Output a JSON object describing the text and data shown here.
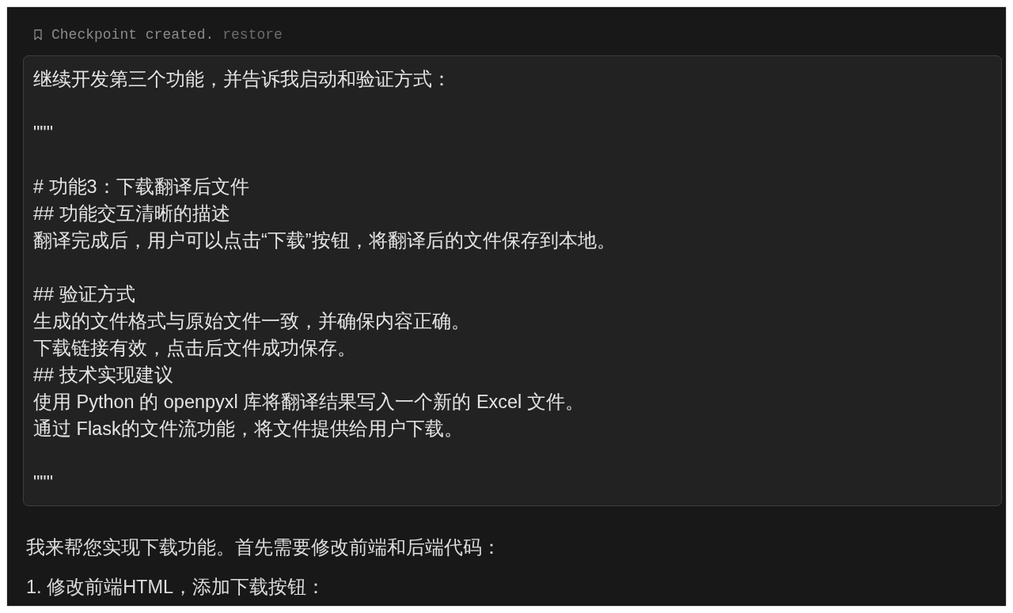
{
  "checkpoint": {
    "label": "Checkpoint created.",
    "action": "restore"
  },
  "user_message": {
    "blocks": [
      [
        "继续开发第三个功能，并告诉我启动和验证方式："
      ],
      [
        "\"\"\""
      ],
      [
        "# 功能3：下载翻译后文件",
        "## 功能交互清晰的描述",
        "翻译完成后，用户可以点击“下载”按钮，将翻译后的文件保存到本地。"
      ],
      [
        "## 验证方式",
        "生成的文件格式与原始文件一致，并确保内容正确。",
        "下载链接有效，点击后文件成功保存。",
        "## 技术实现建议",
        "使用 Python 的 openpyxl 库将翻译结果写入一个新的 Excel 文件。",
        "通过 Flask的文件流功能，将文件提供给用户下载。"
      ],
      [
        "\"\"\""
      ]
    ]
  },
  "assistant_message": {
    "paragraphs": [
      "我来帮您实现下载功能。首先需要修改前端和后端代码：",
      "1. 修改前端HTML，添加下载按钮："
    ]
  }
}
